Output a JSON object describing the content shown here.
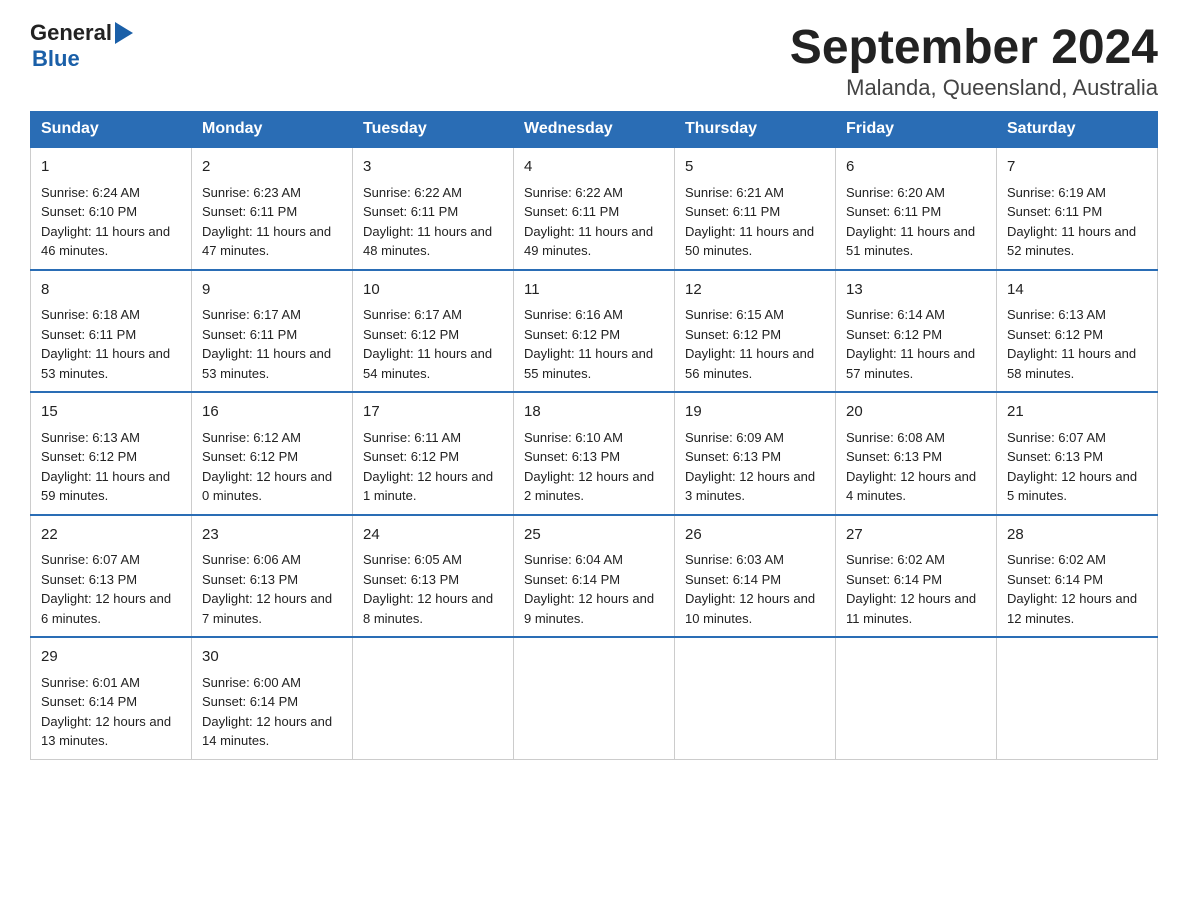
{
  "logo": {
    "general": "General",
    "blue": "Blue"
  },
  "title": "September 2024",
  "subtitle": "Malanda, Queensland, Australia",
  "weekdays": [
    "Sunday",
    "Monday",
    "Tuesday",
    "Wednesday",
    "Thursday",
    "Friday",
    "Saturday"
  ],
  "weeks": [
    [
      {
        "day": "1",
        "sunrise": "6:24 AM",
        "sunset": "6:10 PM",
        "daylight": "11 hours and 46 minutes."
      },
      {
        "day": "2",
        "sunrise": "6:23 AM",
        "sunset": "6:11 PM",
        "daylight": "11 hours and 47 minutes."
      },
      {
        "day": "3",
        "sunrise": "6:22 AM",
        "sunset": "6:11 PM",
        "daylight": "11 hours and 48 minutes."
      },
      {
        "day": "4",
        "sunrise": "6:22 AM",
        "sunset": "6:11 PM",
        "daylight": "11 hours and 49 minutes."
      },
      {
        "day": "5",
        "sunrise": "6:21 AM",
        "sunset": "6:11 PM",
        "daylight": "11 hours and 50 minutes."
      },
      {
        "day": "6",
        "sunrise": "6:20 AM",
        "sunset": "6:11 PM",
        "daylight": "11 hours and 51 minutes."
      },
      {
        "day": "7",
        "sunrise": "6:19 AM",
        "sunset": "6:11 PM",
        "daylight": "11 hours and 52 minutes."
      }
    ],
    [
      {
        "day": "8",
        "sunrise": "6:18 AM",
        "sunset": "6:11 PM",
        "daylight": "11 hours and 53 minutes."
      },
      {
        "day": "9",
        "sunrise": "6:17 AM",
        "sunset": "6:11 PM",
        "daylight": "11 hours and 53 minutes."
      },
      {
        "day": "10",
        "sunrise": "6:17 AM",
        "sunset": "6:12 PM",
        "daylight": "11 hours and 54 minutes."
      },
      {
        "day": "11",
        "sunrise": "6:16 AM",
        "sunset": "6:12 PM",
        "daylight": "11 hours and 55 minutes."
      },
      {
        "day": "12",
        "sunrise": "6:15 AM",
        "sunset": "6:12 PM",
        "daylight": "11 hours and 56 minutes."
      },
      {
        "day": "13",
        "sunrise": "6:14 AM",
        "sunset": "6:12 PM",
        "daylight": "11 hours and 57 minutes."
      },
      {
        "day": "14",
        "sunrise": "6:13 AM",
        "sunset": "6:12 PM",
        "daylight": "11 hours and 58 minutes."
      }
    ],
    [
      {
        "day": "15",
        "sunrise": "6:13 AM",
        "sunset": "6:12 PM",
        "daylight": "11 hours and 59 minutes."
      },
      {
        "day": "16",
        "sunrise": "6:12 AM",
        "sunset": "6:12 PM",
        "daylight": "12 hours and 0 minutes."
      },
      {
        "day": "17",
        "sunrise": "6:11 AM",
        "sunset": "6:12 PM",
        "daylight": "12 hours and 1 minute."
      },
      {
        "day": "18",
        "sunrise": "6:10 AM",
        "sunset": "6:13 PM",
        "daylight": "12 hours and 2 minutes."
      },
      {
        "day": "19",
        "sunrise": "6:09 AM",
        "sunset": "6:13 PM",
        "daylight": "12 hours and 3 minutes."
      },
      {
        "day": "20",
        "sunrise": "6:08 AM",
        "sunset": "6:13 PM",
        "daylight": "12 hours and 4 minutes."
      },
      {
        "day": "21",
        "sunrise": "6:07 AM",
        "sunset": "6:13 PM",
        "daylight": "12 hours and 5 minutes."
      }
    ],
    [
      {
        "day": "22",
        "sunrise": "6:07 AM",
        "sunset": "6:13 PM",
        "daylight": "12 hours and 6 minutes."
      },
      {
        "day": "23",
        "sunrise": "6:06 AM",
        "sunset": "6:13 PM",
        "daylight": "12 hours and 7 minutes."
      },
      {
        "day": "24",
        "sunrise": "6:05 AM",
        "sunset": "6:13 PM",
        "daylight": "12 hours and 8 minutes."
      },
      {
        "day": "25",
        "sunrise": "6:04 AM",
        "sunset": "6:14 PM",
        "daylight": "12 hours and 9 minutes."
      },
      {
        "day": "26",
        "sunrise": "6:03 AM",
        "sunset": "6:14 PM",
        "daylight": "12 hours and 10 minutes."
      },
      {
        "day": "27",
        "sunrise": "6:02 AM",
        "sunset": "6:14 PM",
        "daylight": "12 hours and 11 minutes."
      },
      {
        "day": "28",
        "sunrise": "6:02 AM",
        "sunset": "6:14 PM",
        "daylight": "12 hours and 12 minutes."
      }
    ],
    [
      {
        "day": "29",
        "sunrise": "6:01 AM",
        "sunset": "6:14 PM",
        "daylight": "12 hours and 13 minutes."
      },
      {
        "day": "30",
        "sunrise": "6:00 AM",
        "sunset": "6:14 PM",
        "daylight": "12 hours and 14 minutes."
      },
      null,
      null,
      null,
      null,
      null
    ]
  ],
  "labels": {
    "sunrise": "Sunrise:",
    "sunset": "Sunset:",
    "daylight": "Daylight:"
  }
}
